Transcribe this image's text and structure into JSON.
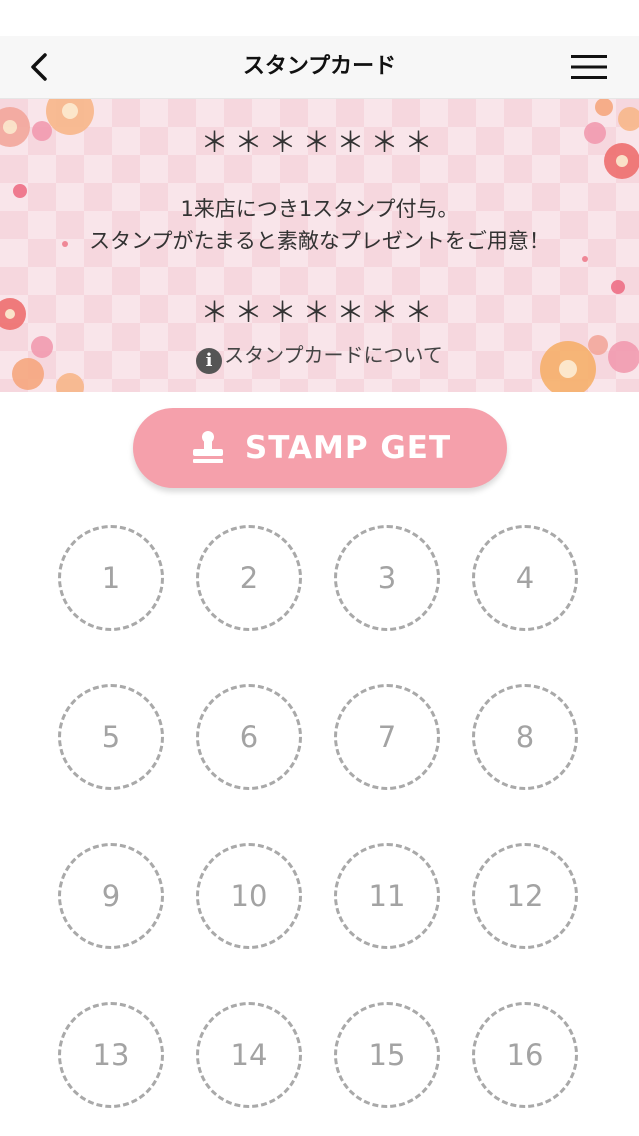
{
  "nav": {
    "title": "スタンプカード",
    "back_icon": "chevron-left-icon",
    "menu_icon": "hamburger-menu-icon"
  },
  "banner": {
    "stars_top": "＊＊＊＊＊＊＊",
    "line1": "1来店につき1スタンプ付与。",
    "line2": "スタンプがたまると素敵なプレゼントをご用意！",
    "stars_bottom": "＊＊＊＊＊＊＊",
    "about_label": "スタンプカードについて",
    "about_icon": "info-icon",
    "info_glyph": "i"
  },
  "stamp_button": {
    "label": "STAMP GET",
    "icon": "stamp-icon"
  },
  "colors": {
    "accent": "#f5a0ab",
    "slot_border": "#a9a9a9",
    "slot_text": "#a3a3a3"
  },
  "stamps": [
    "1",
    "2",
    "3",
    "4",
    "5",
    "6",
    "7",
    "8",
    "9",
    "10",
    "11",
    "12",
    "13",
    "14",
    "15",
    "16"
  ]
}
